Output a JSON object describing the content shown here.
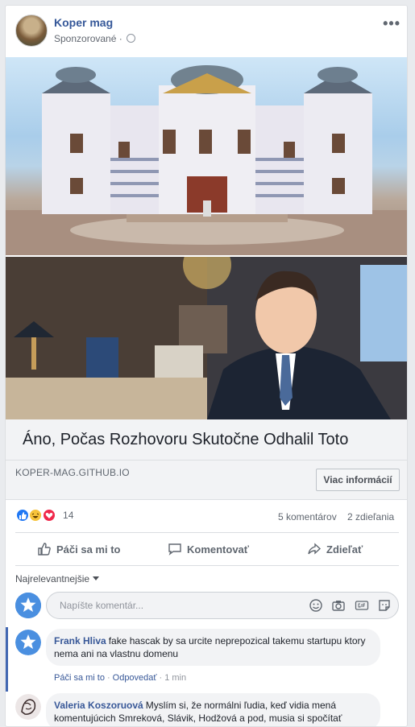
{
  "post": {
    "page_name": "Koper mag",
    "sponsored": "Sponzorované ·",
    "headline": "Áno, Počas Rozhovoru Skutočne Odhalil Toto",
    "domain": "KOPER-MAG.GITHUB.IO",
    "cta_label": "Viac informácií"
  },
  "stats": {
    "reaction_count": "14",
    "comments": "5 komentárov",
    "shares": "2 zdieľania"
  },
  "actions": {
    "like": "Páči sa mi to",
    "comment": "Komentovať",
    "share": "Zdieľať"
  },
  "comments_section": {
    "sort_label": "Najrelevantnejšie",
    "compose_placeholder": "Napíšte komentár...",
    "items": [
      {
        "author": "Frank Hliva",
        "text": "fake hascak by sa urcite neprepozical takemu startupu ktory nema ani na vlastnu domenu",
        "like_label": "Páči sa mi to",
        "reply_label": "Odpovedať",
        "time": "1 min"
      },
      {
        "author": "Valeria Koszoruová",
        "text": "Myslím si, že normálni ľudia, keď vidia mená komentujúcich Smreková, Slávik, Hodžová a pod, musia si spočítať"
      }
    ]
  },
  "icons": {
    "more": "more-options-icon",
    "globe": "globe-icon",
    "like": "thumbs-up-icon",
    "comment": "speech-bubble-icon",
    "share": "share-arrow-icon",
    "emoji": "smiley-icon",
    "camera": "camera-icon",
    "gif": "gif-icon",
    "sticker": "sticker-icon"
  },
  "colors": {
    "link_blue": "#365899",
    "like_blue": "#2078f4",
    "haha_yellow": "#f7c33b",
    "love_red": "#f0284a"
  }
}
